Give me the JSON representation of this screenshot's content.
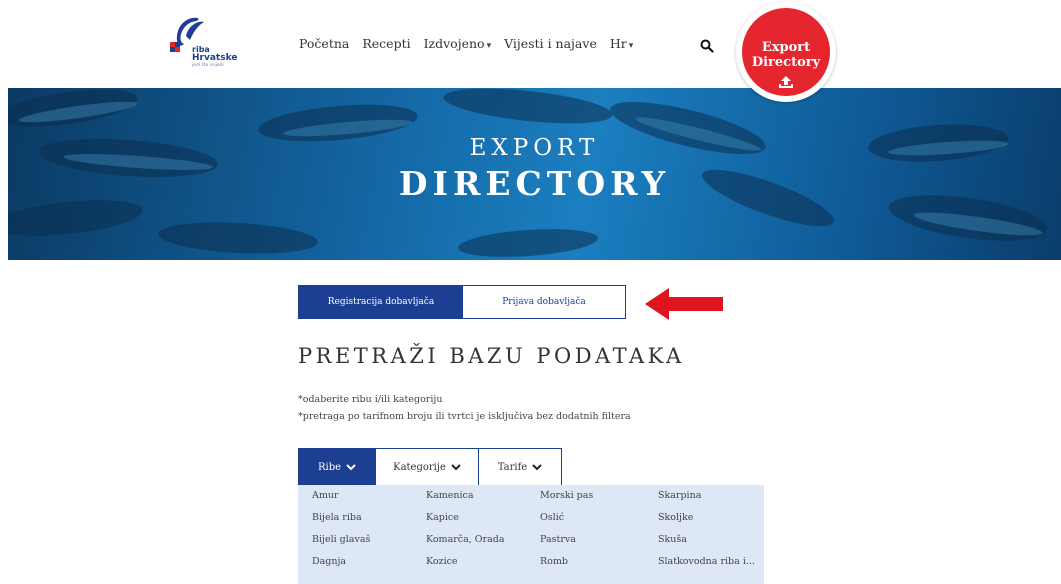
{
  "logo": {
    "line1": "riba",
    "line2": "Hrvatske",
    "line3": "jedi što vrijedi"
  },
  "nav": {
    "items": [
      {
        "label": "Početna",
        "dropdown": false
      },
      {
        "label": "Recepti",
        "dropdown": false
      },
      {
        "label": "Izdvojeno",
        "dropdown": true
      },
      {
        "label": "Vijesti i najave",
        "dropdown": false
      },
      {
        "label": "Hr",
        "dropdown": true
      }
    ],
    "search_icon": "search-icon"
  },
  "export_button": {
    "line1": "Export",
    "line2": "Directory",
    "icon": "upload-icon"
  },
  "hero": {
    "small": "EXPORT",
    "big": "DIRECTORY"
  },
  "supplier_tabs": {
    "register": "Registracija dobavljača",
    "login": "Prijava dobavljača"
  },
  "search": {
    "title": "PRETRAŽI BAZU PODATAKA",
    "hint1": "*odaberite ribu i/ili kategoriju",
    "hint2": "*pretraga po tarifnom broju ili tvrtci je isključiva bez dodatnih filtera"
  },
  "filter_tabs": [
    {
      "label": "Ribe"
    },
    {
      "label": "Kategorije"
    },
    {
      "label": "Tarife"
    }
  ],
  "fish_list": [
    "Amur",
    "Kamenica",
    "Morski pas",
    "Škarpina",
    "Bijela riba",
    "Kapice",
    "Oslić",
    "Školjke",
    "Bijeli glavaš",
    "Komarča, Orada",
    "Pastrva",
    "Skuša",
    "Dagnja",
    "Kozice",
    "Romb",
    "Slatkovodna riba i..."
  ],
  "colors": {
    "brand_blue": "#1c3f94",
    "accent_red": "#e5262f",
    "grid_bg": "#dde7f5"
  }
}
